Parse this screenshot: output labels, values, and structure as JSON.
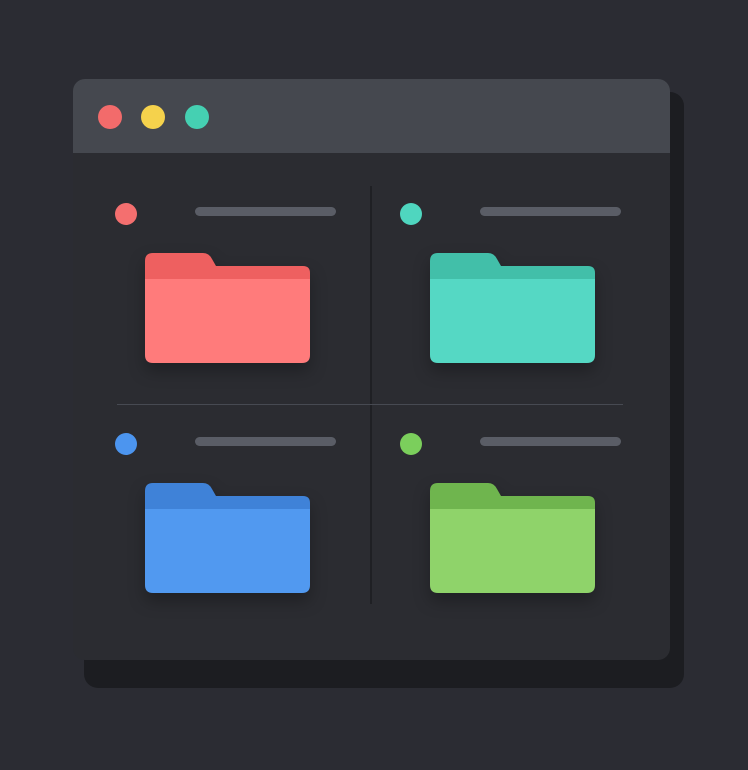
{
  "window": {
    "traffic_lights": [
      {
        "name": "close",
        "color": "#f26b6b"
      },
      {
        "name": "minimize",
        "color": "#f5d24c"
      },
      {
        "name": "maximize",
        "color": "#45d0b2"
      }
    ]
  },
  "tiles": [
    {
      "accent": "#f46f6f",
      "folder_back": "#ee6060",
      "folder_front": "#ff7b7b",
      "icon": "folder-icon"
    },
    {
      "accent": "#4fd6bf",
      "folder_back": "#42bfa9",
      "folder_front": "#55d8c4",
      "icon": "folder-icon"
    },
    {
      "accent": "#4c95ef",
      "folder_back": "#3f82d8",
      "folder_front": "#5199f0",
      "icon": "folder-icon"
    },
    {
      "accent": "#7bcf5c",
      "folder_back": "#6fb54e",
      "folder_front": "#8fd36a",
      "icon": "folder-icon"
    }
  ]
}
